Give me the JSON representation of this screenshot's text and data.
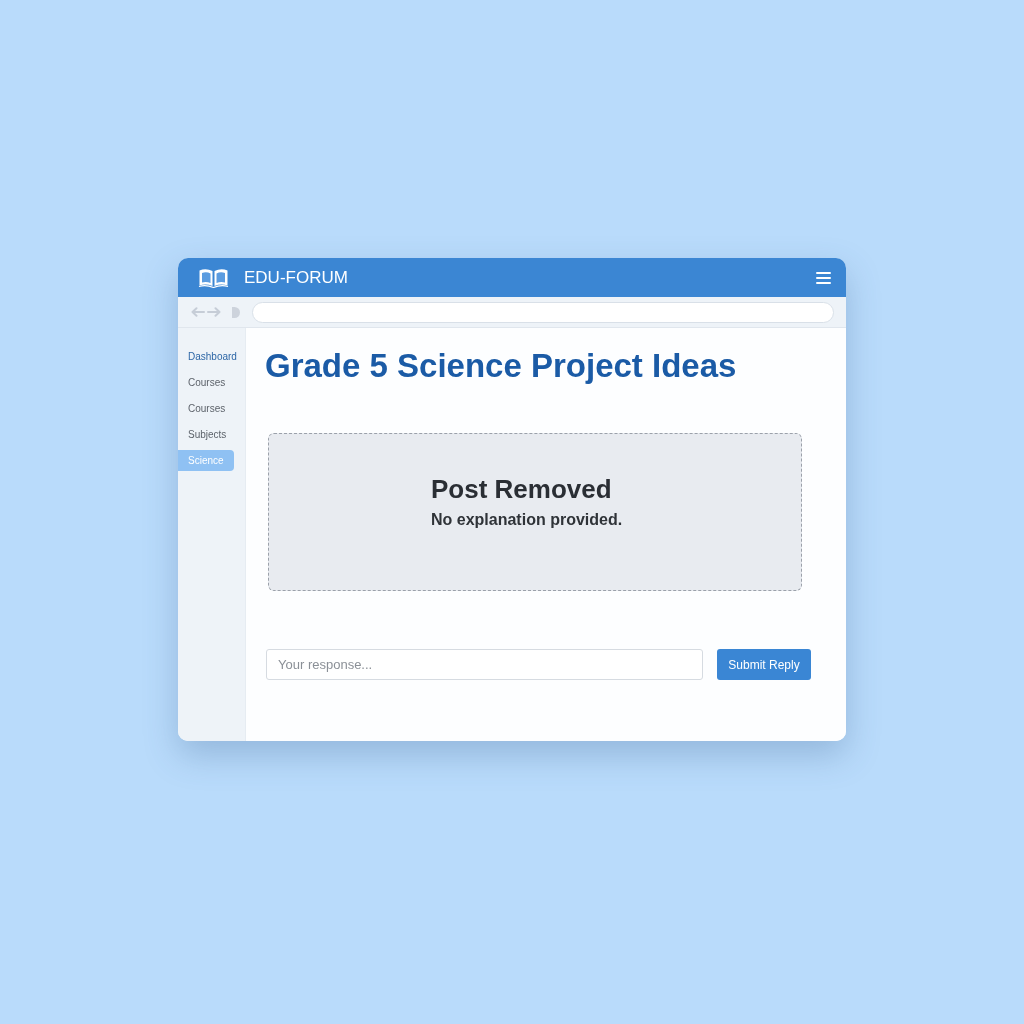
{
  "header": {
    "title": "EDU-FORUM"
  },
  "sidebar": {
    "items": [
      {
        "label": "Dashboard",
        "kind": "heading",
        "selected": false
      },
      {
        "label": "Courses",
        "kind": "link",
        "selected": false
      },
      {
        "label": "Courses",
        "kind": "link",
        "selected": false
      },
      {
        "label": "Subjects",
        "kind": "link",
        "selected": false
      },
      {
        "label": "Science",
        "kind": "link",
        "selected": true
      }
    ]
  },
  "page": {
    "title": "Grade 5 Science Project Ideas"
  },
  "notice": {
    "title": "Post Removed",
    "message": "No explanation provided."
  },
  "reply": {
    "placeholder": "Your response...",
    "button": "Submit Reply"
  }
}
